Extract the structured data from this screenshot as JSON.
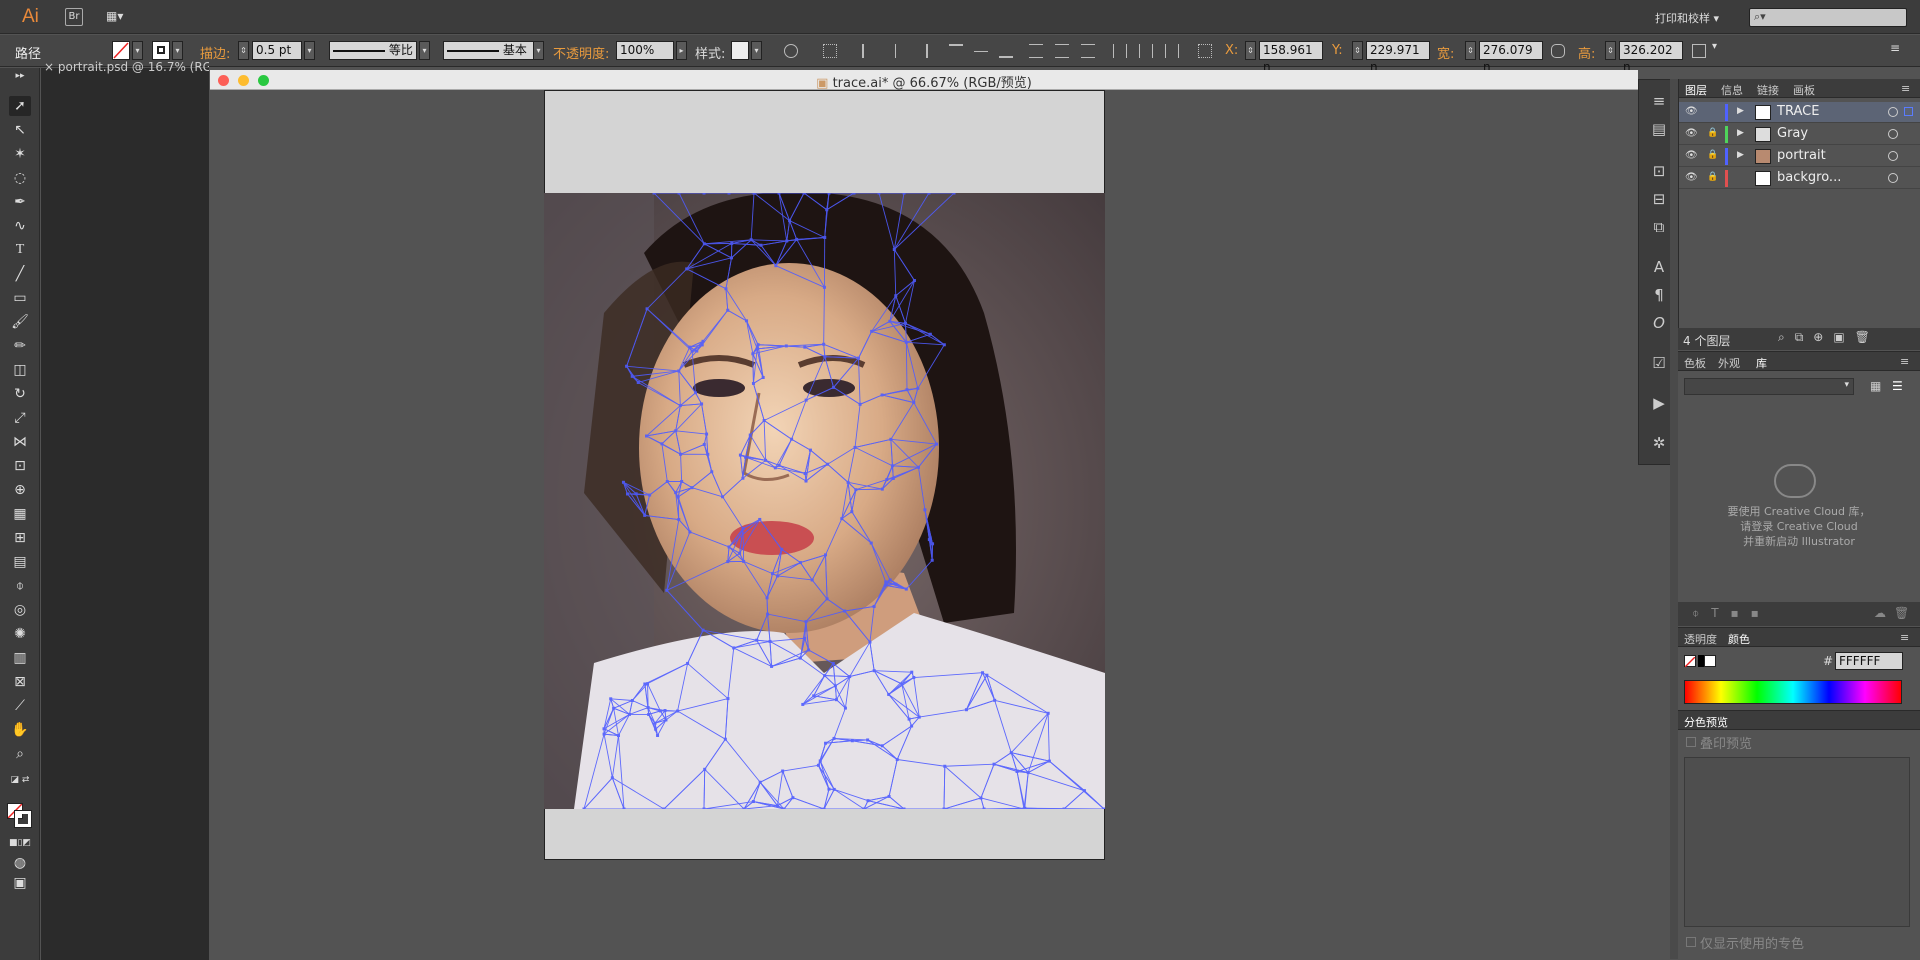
{
  "app": {
    "logo": "Ai",
    "bridge_label": "Br",
    "workspace_label": "▦▾",
    "print_menu": "打印和校样",
    "search_placeholder": ""
  },
  "control_bar": {
    "object_type": "路径",
    "stroke_label": "描边:",
    "stroke_weight": "0.5 pt",
    "profile_label": "等比",
    "brush_label": "基本",
    "opacity_label": "不透明度:",
    "opacity_value": "100%",
    "style_label": "样式:",
    "x_label": "X:",
    "x_value": "158.961 n",
    "y_label": "Y:",
    "y_value": "229.971 n",
    "w_label": "宽:",
    "w_value": "276.079 n",
    "h_label": "高:",
    "h_value": "326.202 n"
  },
  "tabs": {
    "background_tab": "portrait.psd @ 16.7% (RG"
  },
  "document": {
    "title": "trace.ai* @ 66.67% (RGB/预览)"
  },
  "layers_panel": {
    "tabs": [
      "图层",
      "信息",
      "链接",
      "画板"
    ],
    "layers": [
      {
        "name": "TRACE",
        "color": "#4f62ff",
        "selected": true
      },
      {
        "name": "Gray",
        "color": "#4fd45a",
        "selected": false
      },
      {
        "name": "portrait",
        "color": "#4f62ff",
        "selected": false
      },
      {
        "name": "backgro...",
        "color": "#e05050",
        "selected": false
      }
    ],
    "count_label": "4 个图层"
  },
  "library_panel": {
    "tabs": [
      "色板",
      "外观",
      "库"
    ],
    "message_line1": "要使用 Creative Cloud 库，",
    "message_line2": "请登录 Creative Cloud",
    "message_line3": "并重新启动 Illustrator"
  },
  "color_panel": {
    "tabs": [
      "透明度",
      "颜色"
    ],
    "hex_label": "#",
    "hex_value": "FFFFFF"
  },
  "separation_panel": {
    "title": "分色预览",
    "overprint_label": "叠印预览",
    "spot_only_label": "仅显示使用的专色"
  },
  "colors": {
    "accent_orange": "#e99b3e",
    "mesh_blue": "#4f5cff",
    "selection_blue": "#5c6475"
  }
}
